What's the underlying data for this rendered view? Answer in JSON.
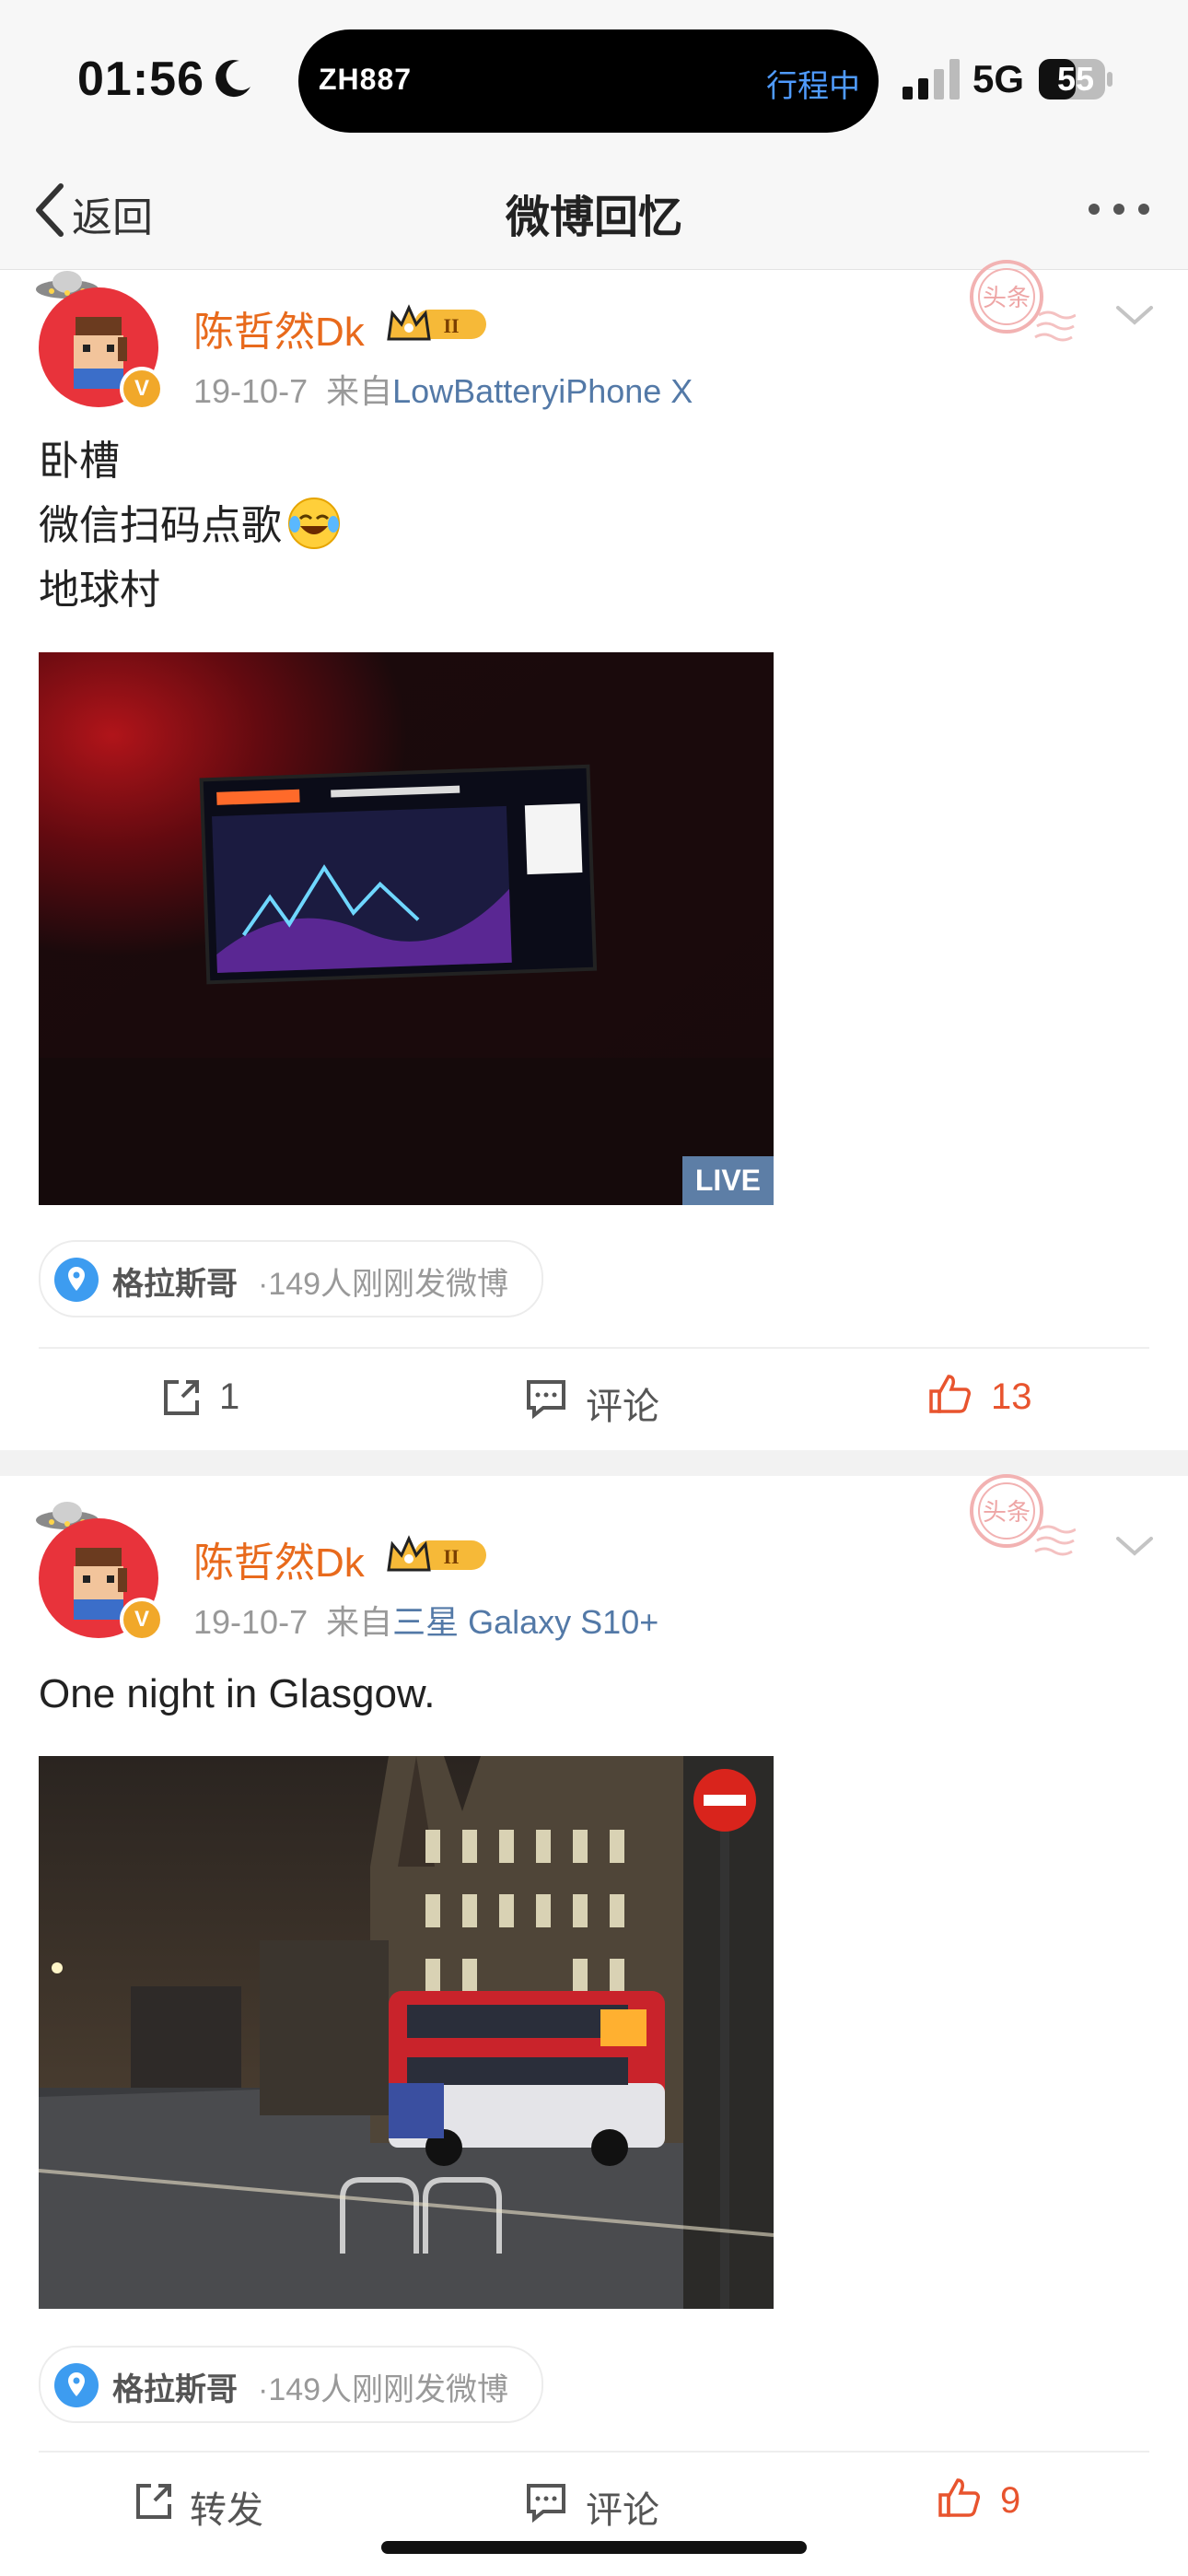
{
  "status": {
    "time": "01:56",
    "island_left": "ZH887",
    "island_right": "行程中",
    "network": "5G",
    "battery": "55"
  },
  "nav": {
    "back_label": "返回",
    "title": "微博回忆"
  },
  "posts": [
    {
      "username": "陈哲然Dk",
      "badge_level": "II",
      "date": "19-10-7",
      "from_prefix": "来自",
      "source": "LowBatteryiPhone X",
      "text_lines": [
        "卧槽",
        "微信扫码点歌",
        "地球村"
      ],
      "emoji": "laugh-cry-emoji",
      "media_badge": "LIVE",
      "location": {
        "name": "格拉斯哥",
        "extra": "·149人刚刚发微博"
      },
      "actions": {
        "repost": "1",
        "comment": "评论",
        "like": "13"
      }
    },
    {
      "username": "陈哲然Dk",
      "badge_level": "II",
      "date": "19-10-7",
      "from_prefix": "来自",
      "source": "三星 Galaxy S10+",
      "text_lines": [
        "One night in Glasgow."
      ],
      "location": {
        "name": "格拉斯哥",
        "extra": "·149人刚刚发微博"
      },
      "actions": {
        "repost": "转发",
        "comment": "评论",
        "like": "9"
      }
    }
  ],
  "stamp_text": "头条",
  "colors": {
    "username": "#e86a1c",
    "source_link": "#5379a7",
    "like_active": "#e8542e",
    "island_accent": "#4f9bff"
  }
}
